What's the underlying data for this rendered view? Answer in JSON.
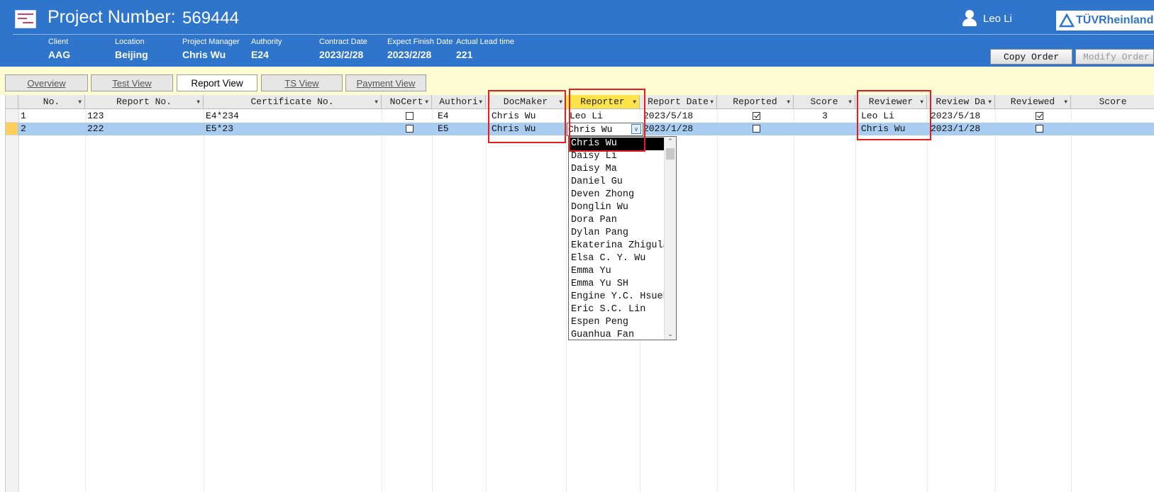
{
  "header": {
    "title_label": "Project Number:",
    "project_number": "569444",
    "user_name": "Leo Li",
    "logo_text": "TÜVRheinland",
    "info": [
      {
        "label": "Client",
        "value": "AAG"
      },
      {
        "label": "Location",
        "value": "Beijing"
      },
      {
        "label": "Project Manager",
        "value": "Chris Wu"
      },
      {
        "label": "Authority",
        "value": "E24"
      },
      {
        "label": "Contract Date",
        "value": "2023/2/28"
      },
      {
        "label": "Expect Finish Date",
        "value": "2023/2/28"
      },
      {
        "label": "Actual Lead time",
        "value": "221"
      }
    ],
    "copy_order_label": "Copy Order",
    "modify_order_label": "Modify Order"
  },
  "tabs": [
    {
      "label": "Overview"
    },
    {
      "label": "Test View"
    },
    {
      "label": "Report View",
      "active": true
    },
    {
      "label": "TS View"
    },
    {
      "label": "Payment View"
    }
  ],
  "grid": {
    "columns": [
      "No.",
      "Report No.",
      "Certificate No.",
      "NoCert",
      "Authori",
      "DocMaker",
      "Reporter",
      "Report Date",
      "Reported",
      "Score",
      "Reviewer",
      "Review Da",
      "Reviewed",
      "Score"
    ],
    "rows": [
      {
        "no": "1",
        "report_no": "123",
        "certificate_no": "E4*234",
        "nocert": false,
        "authority": "E4",
        "docmaker": "Chris Wu",
        "reporter": "Leo Li",
        "report_date": "2023/5/18",
        "reported": true,
        "score": "3",
        "reviewer": "Leo Li",
        "review_date": "2023/5/18",
        "reviewed": true,
        "score2": ""
      },
      {
        "no": "2",
        "report_no": "222",
        "certificate_no": "E5*23",
        "nocert": false,
        "authority": "E5",
        "docmaker": "Chris Wu",
        "reporter": "Chris Wu",
        "report_date": "2023/1/28",
        "reported": false,
        "score": "",
        "reviewer": "Chris Wu",
        "review_date": "2023/1/28",
        "reviewed": false,
        "score2": ""
      }
    ]
  },
  "reporter_dropdown": {
    "current_value": "Chris Wu",
    "options": [
      "Chris Wu",
      "Daisy Li",
      "Daisy Ma",
      "Daniel Gu",
      "Deven Zhong",
      "Donglin Wu",
      "Dora Pan",
      "Dylan Pang",
      "Ekaterina Zhigula",
      "Elsa C. Y. Wu",
      "Emma Yu",
      "Emma Yu SH",
      "Engine Y.C. Hsueh",
      "Eric S.C. Lin",
      "Espen Peng",
      "Guanhua Fan"
    ],
    "selected_index": 0
  },
  "colors": {
    "header_blue": "#2e75cb",
    "tab_strip": "#fefcd2",
    "selected_row": "#a8cdf0",
    "highlight_header": "#ffe34a",
    "annotation_red": "#e81c1c"
  }
}
